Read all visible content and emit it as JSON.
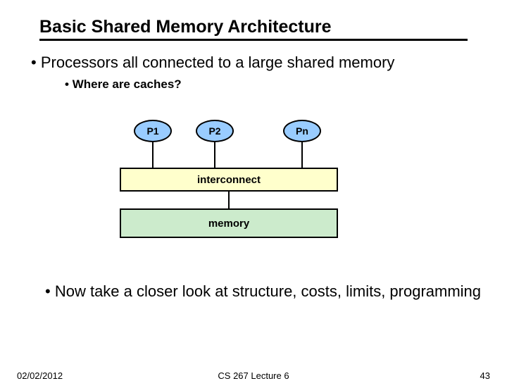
{
  "title": "Basic Shared Memory Architecture",
  "bullets": {
    "b1": "Processors all connected to a large shared memory",
    "b2": "Where are caches?",
    "closing": "Now take a closer look at structure, costs, limits, programming"
  },
  "diagram": {
    "p1": "P1",
    "p2": "P2",
    "pn": "Pn",
    "interconnect": "interconnect",
    "memory": "memory"
  },
  "footer": {
    "date": "02/02/2012",
    "center": "CS 267 Lecture 6",
    "page": "43"
  }
}
